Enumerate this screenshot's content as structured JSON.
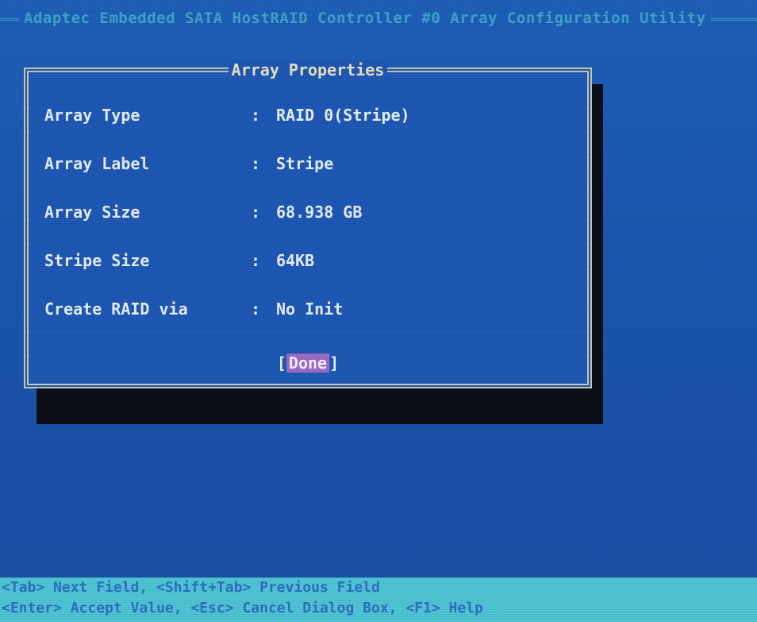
{
  "title_bar": {
    "title": "Adaptec Embedded SATA HostRAID Controller #0 Array Configuration Utility"
  },
  "dialog": {
    "title": "Array Properties",
    "fields": [
      {
        "label": "Array Type",
        "colon": ":",
        "value": "RAID 0(Stripe)"
      },
      {
        "label": "Array Label",
        "colon": ":",
        "value": "Stripe"
      },
      {
        "label": "Array Size",
        "colon": ":",
        "value": "68.938 GB"
      },
      {
        "label": "Stripe Size",
        "colon": ":",
        "value": "64KB"
      },
      {
        "label": "Create RAID via",
        "colon": ":",
        "value": "No Init"
      }
    ],
    "done_open": "[",
    "done_label": "Done",
    "done_close": "]"
  },
  "help_bar": {
    "line1": "<Tab> Next Field, <Shift+Tab> Previous Field",
    "line2": "<Enter> Accept Value, <Esc> Cancel Dialog Box, <F1> Help"
  },
  "colors": {
    "background": "#1b56ae",
    "title_text": "#3fa3c9",
    "dialog_bg": "#1e58b4",
    "dialog_border": "#c8c8b0",
    "highlight": "#9a6cc6",
    "help_bar_bg": "#4ec4d4",
    "help_bar_text": "#2e6fc0"
  }
}
